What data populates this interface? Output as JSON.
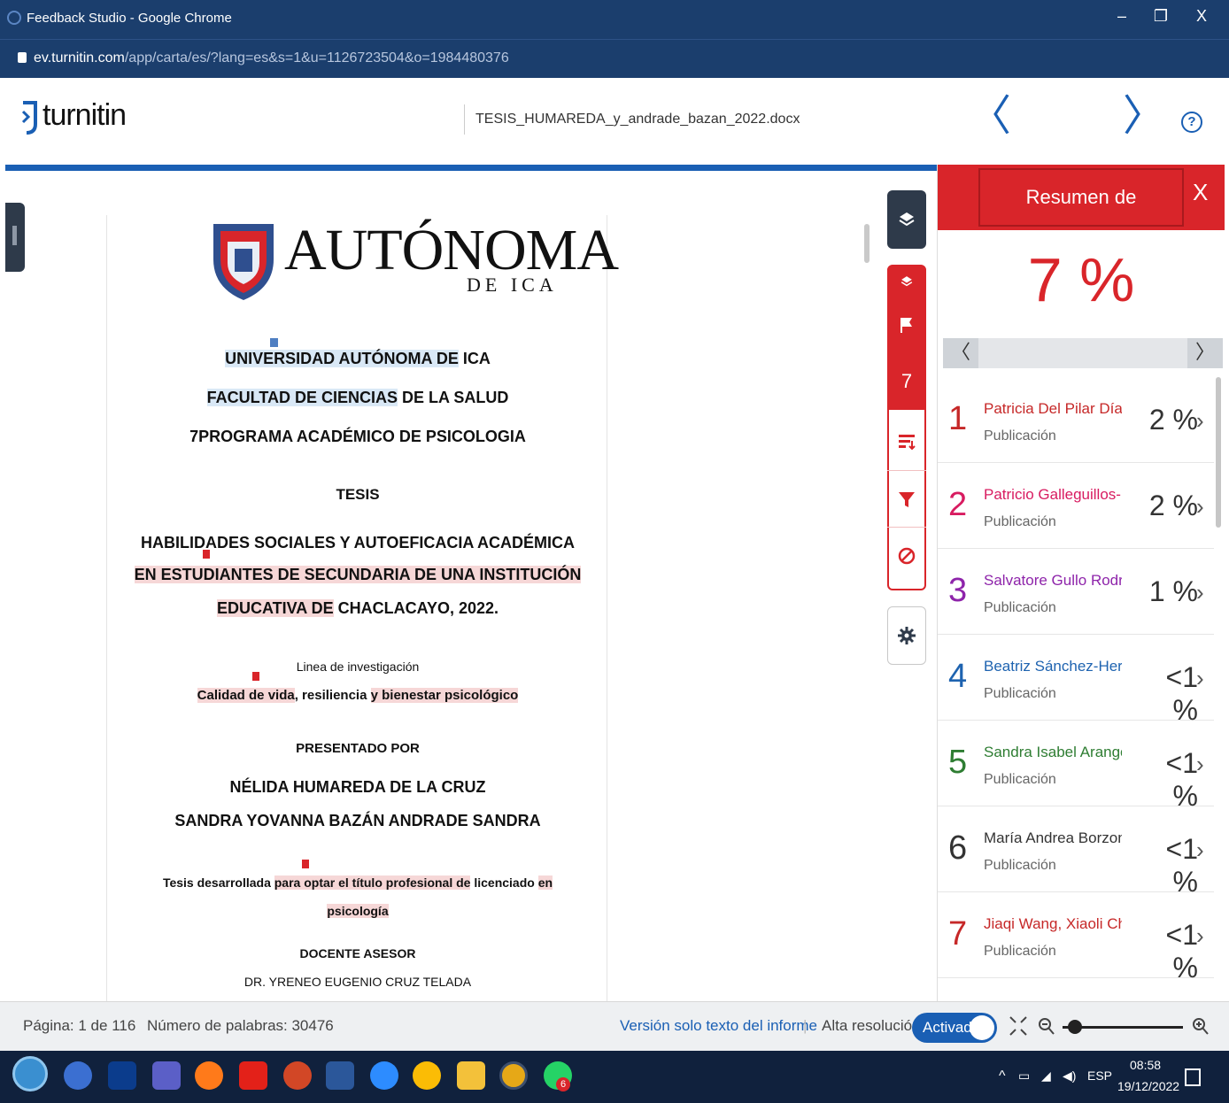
{
  "browser": {
    "window_title": "Feedback Studio - Google Chrome",
    "url_host": "ev.turnitin.com",
    "url_path": "/app/carta/es/?lang=es&s=1&u=1126723504&o=1984480376",
    "minimize": "–",
    "restore": "❐",
    "close": "X"
  },
  "header": {
    "logo_text": "turnitin",
    "filename": "TESIS_HUMAREDA_y_andrade_bazan_2022.docx",
    "prev": "〈",
    "next": "〉",
    "help": "?"
  },
  "document": {
    "logo_main": "AUTÓNOMA",
    "logo_sub": "DE ICA",
    "line_university_hl": "UNIVERSIDAD AUTÓNOMA DE",
    "line_university_rest": " ICA",
    "line_faculty_hl": "FACULTAD DE CIENCIAS",
    "line_faculty_rest": " DE LA SALUD",
    "line_program": "7PROGRAMA ACADÉMICO DE PSICOLOGIA",
    "line_tesis": "TESIS",
    "title_1": "HABILIDADES SOCIALES Y AUTOEFICACIA ACADÉMICA",
    "title_2": "EN ESTUDIANTES DE SECUNDARIA DE UNA INSTITUCIÓN",
    "title_3_hl": "EDUCATIVA DE",
    "title_3_rest": " CHACLACAYO, 2022.",
    "research_label": "Linea de investigación",
    "research_hl1": "Calidad de vida",
    "research_mid": ", resiliencia ",
    "research_hl2": "y bienestar psicológico",
    "presented_by": "PRESENTADO POR",
    "author_1": "NÉLIDA HUMAREDA DE LA CRUZ",
    "author_2": "SANDRA YOVANNA BAZÁN ANDRADE SANDRA",
    "thesis_pre": "Tesis desarrollada ",
    "thesis_hl1": "para optar el título profesional de",
    "thesis_mid": " licenciado ",
    "thesis_hl2": "en",
    "thesis_hl3": "psicología",
    "advisor_label": "DOCENTE ASESOR",
    "advisor_name": "DR. YRENEO EUGENIO CRUZ TELADA",
    "marker_blue": "23"
  },
  "toolbar": {
    "match_count": "7"
  },
  "sidebar": {
    "title": "Resumen de coincidencias",
    "close": "X",
    "percent": "7 %",
    "pager_prev": "〈",
    "pager_next": "〉",
    "matches": [
      {
        "num": "1",
        "name": "Patricia Del Pilar Díaz ...",
        "type": "Publicación",
        "pct": "2 %",
        "color": "#c62828"
      },
      {
        "num": "2",
        "name": "Patricio Galleguillos-He...",
        "type": "Publicación",
        "pct": "2 %",
        "color": "#d81b60"
      },
      {
        "num": "3",
        "name": "Salvatore Gullo Rodrígu...",
        "type": "Publicación",
        "pct": "1 %",
        "color": "#8e24aa"
      },
      {
        "num": "4",
        "name": "Beatriz Sánchez-Herna...",
        "type": "Publicación",
        "pct": "<1 %",
        "color": "#1e63b0"
      },
      {
        "num": "5",
        "name": "Sandra Isabel Arango-V...",
        "type": "Publicación",
        "pct": "<1 %",
        "color": "#2e7d32"
      },
      {
        "num": "6",
        "name": "María Andrea Borzone ...",
        "type": "Publicación",
        "pct": "<1 %",
        "color": "#333333"
      },
      {
        "num": "7",
        "name": "Jiaqi Wang, Xiaoli Chen...",
        "type": "Publicación",
        "pct": "<1 %",
        "color": "#c62828"
      }
    ]
  },
  "status": {
    "page": "Página: 1 de 116",
    "words": "Número de palabras: 30476",
    "text_only": "Versión solo texto del informe",
    "separator": "|",
    "high_res": "Alta resolución",
    "toggle": "Activado"
  },
  "taskbar": {
    "lang": "ESP",
    "time": "08:58",
    "date": "19/12/2022",
    "chat_badge": "6"
  },
  "colors": {
    "accent_red": "#d9252a",
    "brand_blue": "#1a5fb4",
    "chrome_blue": "#1b3e6d"
  }
}
